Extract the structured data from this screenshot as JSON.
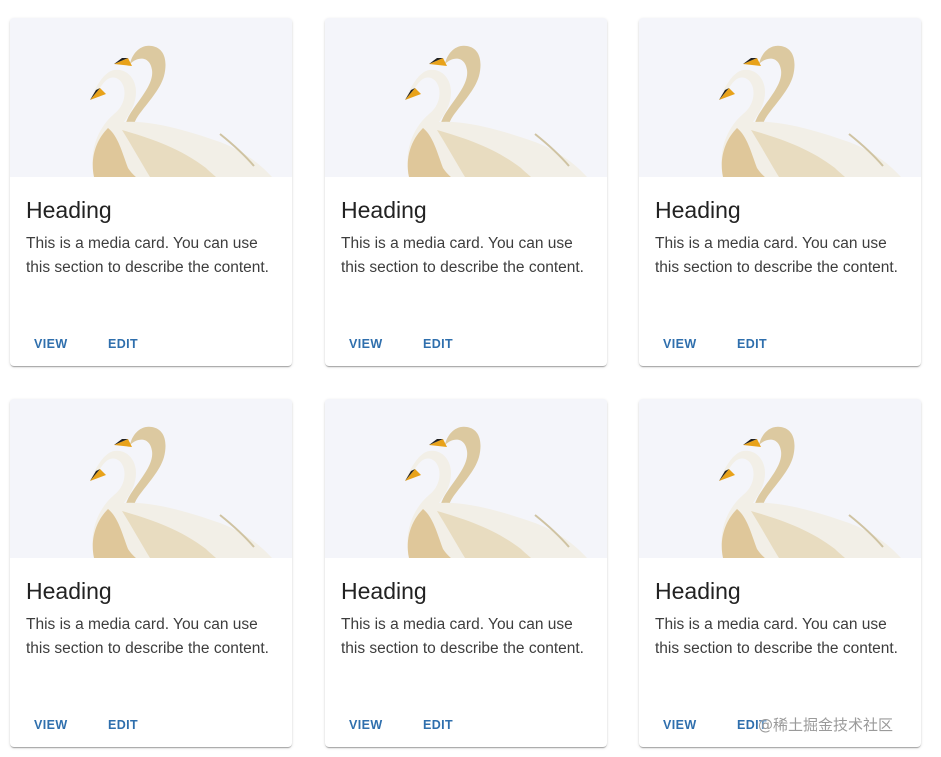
{
  "cards": [
    {
      "heading": "Heading",
      "description": "This is a media card. You can use this section to describe the content.",
      "view_label": "VIEW",
      "edit_label": "EDIT",
      "image": "swan-image"
    },
    {
      "heading": "Heading",
      "description": "This is a media card. You can use this section to describe the content.",
      "view_label": "VIEW",
      "edit_label": "EDIT",
      "image": "swan-image"
    },
    {
      "heading": "Heading",
      "description": "This is a media card. You can use this section to describe the content.",
      "view_label": "VIEW",
      "edit_label": "EDIT",
      "image": "swan-image"
    },
    {
      "heading": "Heading",
      "description": "This is a media card. You can use this section to describe the content.",
      "view_label": "VIEW",
      "edit_label": "EDIT",
      "image": "swan-image"
    },
    {
      "heading": "Heading",
      "description": "This is a media card. You can use this section to describe the content.",
      "view_label": "VIEW",
      "edit_label": "EDIT",
      "image": "swan-image"
    },
    {
      "heading": "Heading",
      "description": "This is a media card. You can use this section to describe the content.",
      "view_label": "VIEW",
      "edit_label": "EDIT",
      "image": "swan-image"
    }
  ],
  "watermark": "@稀土掘金技术社区",
  "colors": {
    "accent": "#2f6fad",
    "heading": "#222222",
    "body_text": "#3d3d3d",
    "media_bg": "#f4f5fa"
  }
}
